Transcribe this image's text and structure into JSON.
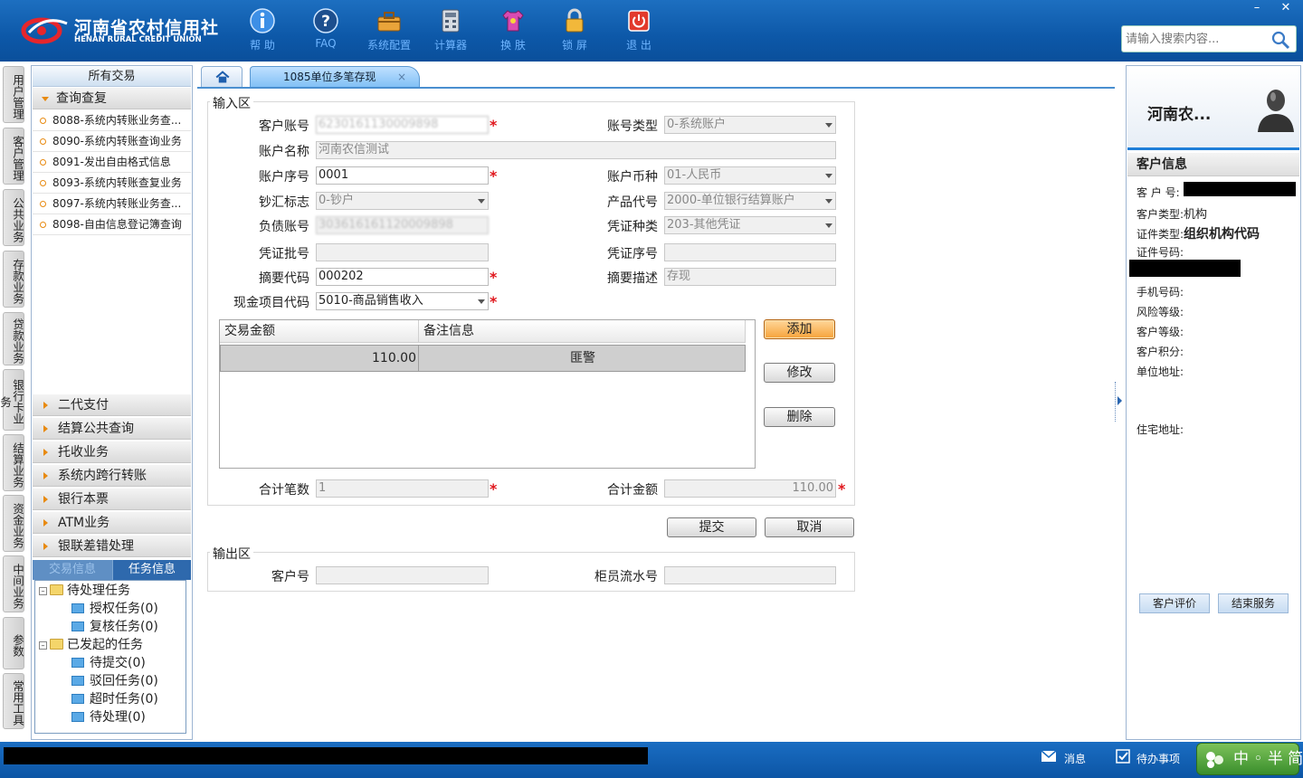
{
  "header": {
    "logo_cn": "河南省农村信用社",
    "logo_en": "HENAN RURAL CREDIT UNION",
    "tools": [
      {
        "label": "帮 助",
        "icon": "info-icon"
      },
      {
        "label": "FAQ",
        "icon": "question-icon"
      },
      {
        "label": "系统配置",
        "icon": "toolbox-icon"
      },
      {
        "label": "计算器",
        "icon": "calculator-icon"
      },
      {
        "label": "换 肤",
        "icon": "shirt-icon"
      },
      {
        "label": "锁 屏",
        "icon": "lock-icon"
      },
      {
        "label": "退 出",
        "icon": "power-icon"
      }
    ],
    "search_placeholder": "请输入搜索内容...",
    "minimize": "–",
    "close": "✕"
  },
  "vtabs": [
    "用户管理",
    "客户管理",
    "公共业务",
    "存款业务",
    "贷款业务",
    "银行卡业务",
    "结算业务",
    "资金业务",
    "中间业务",
    "参数",
    "常用工具"
  ],
  "left": {
    "title": "所有交易",
    "group": "查询查复",
    "items": [
      "8088-系统内转账业务查...",
      "8090-系统内转账查询业务",
      "8091-发出自由格式信息",
      "8093-系统内转账查复业务",
      "8097-系统内转账业务查...",
      "8098-自由信息登记簿查询"
    ],
    "categories": [
      "二代支付",
      "结算公共查询",
      "托收业务",
      "系统内跨行转账",
      "银行本票",
      "ATM业务",
      "银联差错处理"
    ],
    "tabs": [
      "交易信息",
      "任务信息"
    ],
    "tree": {
      "pending": "待处理任务",
      "pending_children": [
        "授权任务(0)",
        "复核任务(0)"
      ],
      "initiated": "已发起的任务",
      "initiated_children": [
        "待提交(0)",
        "驳回任务(0)",
        "超时任务(0)",
        "待处理(0)"
      ]
    }
  },
  "tabs": {
    "active": "1085单位多笔存现",
    "close": "×"
  },
  "input_area": {
    "legend": "输入区",
    "customer_account": {
      "label": "客户账号",
      "value": "6230161130009898"
    },
    "account_type": {
      "label": "账号类型",
      "value": "0-系统账户"
    },
    "account_name": {
      "label": "账户名称",
      "value": "河南农信测试"
    },
    "account_seq": {
      "label": "账户序号",
      "value": "0001"
    },
    "currency": {
      "label": "账户币种",
      "value": "01-人民币"
    },
    "cash_flag": {
      "label": "钞汇标志",
      "value": "0-钞户"
    },
    "product_code": {
      "label": "产品代号",
      "value": "2000-单位银行结算账户"
    },
    "liability_account": {
      "label": "负债账号",
      "value": "303616161120009898"
    },
    "voucher_type": {
      "label": "凭证种类",
      "value": "203-其他凭证"
    },
    "voucher_batch": {
      "label": "凭证批号",
      "value": ""
    },
    "voucher_no": {
      "label": "凭证序号",
      "value": ""
    },
    "summary_code": {
      "label": "摘要代码",
      "value": "000202"
    },
    "summary_desc": {
      "label": "摘要描述",
      "value": "存现"
    },
    "cash_item_code": {
      "label": "现金项目代码",
      "value": "5010-商品销售收入"
    },
    "grid": {
      "columns": [
        "交易金额",
        "备注信息"
      ],
      "rows": [
        {
          "amount": "110.00",
          "remark": "匪警"
        }
      ]
    },
    "buttons": {
      "add": "添加",
      "edit": "修改",
      "delete": "删除"
    },
    "total_count": {
      "label": "合计笔数",
      "value": "1"
    },
    "total_amount": {
      "label": "合计金额",
      "value": "110.00"
    }
  },
  "actions": {
    "submit": "提交",
    "cancel": "取消"
  },
  "output_area": {
    "legend": "输出区",
    "customer_no": {
      "label": "客户号",
      "value": ""
    },
    "teller_seq": {
      "label": "柜员流水号",
      "value": ""
    }
  },
  "right": {
    "name": "河南农...",
    "info_title": "客户信息",
    "fields": {
      "customer_no": "客 户 号:",
      "customer_type_label": "客户类型:",
      "customer_type_value": "机构",
      "id_type_label": "证件类型:",
      "id_type_value": "组织机构代码",
      "id_no": "证件号码:",
      "phone": "手机号码:",
      "risk": "风险等级:",
      "level": "客户等级:",
      "points": "客户积分:",
      "work_addr": "单位地址:",
      "home_addr": "住宅地址:"
    },
    "buttons": {
      "evaluate": "客户评价",
      "end": "结束服务"
    }
  },
  "status": {
    "messages": "消息",
    "todo": "待办事项",
    "ime": "中 ◦ 半 简"
  }
}
